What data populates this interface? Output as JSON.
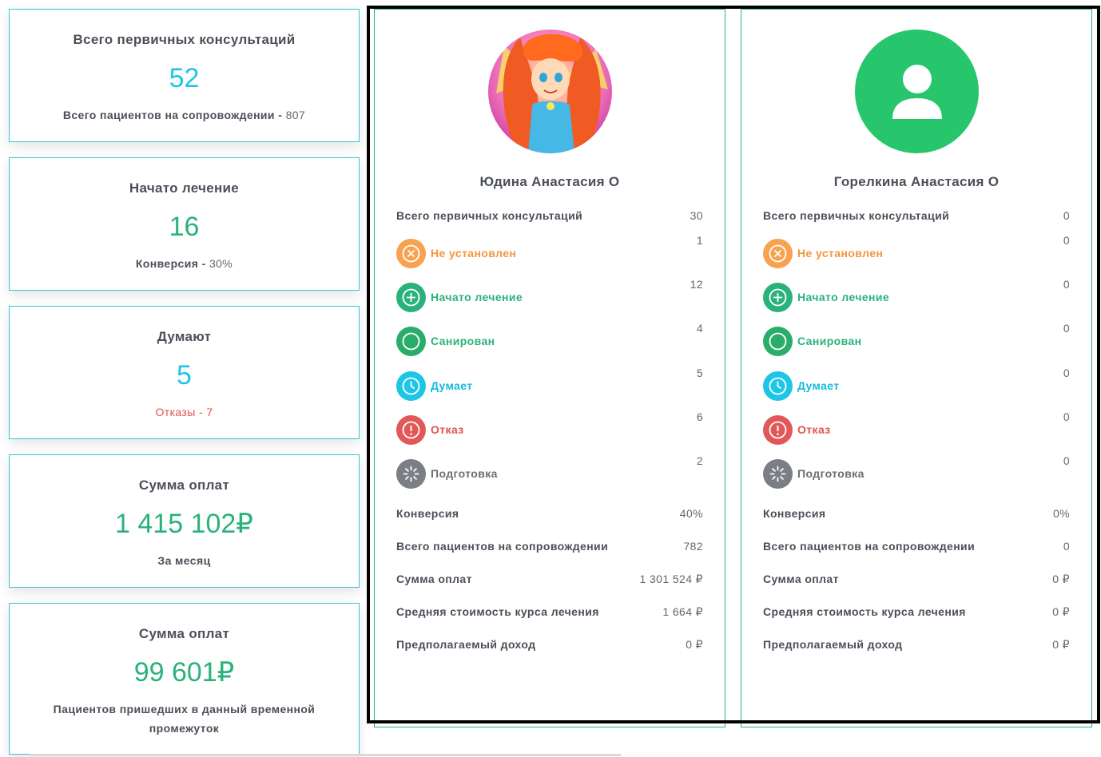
{
  "summary": [
    {
      "title": "Всего первичных консультаций",
      "value": "52",
      "value_color": "cyan",
      "sub_label": "Всего пациентов на сопровождении - ",
      "sub_value": "807"
    },
    {
      "title": "Начато лечение",
      "value": "16",
      "value_color": "green",
      "sub_label": "Конверсия - ",
      "sub_value": "30%"
    },
    {
      "title": "Думают",
      "value": "5",
      "value_color": "cyan",
      "sub_label": "Отказы - ",
      "sub_value": "7"
    },
    {
      "title": "Сумма оплат",
      "value": "1 415 102₽",
      "value_color": "green",
      "sub_label": "За месяц",
      "sub_value": ""
    },
    {
      "title": "Сумма оплат",
      "value": "99 601₽",
      "value_color": "green",
      "sub_label": "Пациентов пришедших в данный временной промежуток",
      "sub_value": ""
    }
  ],
  "employees": [
    {
      "name": "Юдина Анастасия О",
      "total_consultations_label": "Всего первичных консультаций",
      "total_consultations": "30",
      "statuses": [
        {
          "label": "Не установлен",
          "value": "1",
          "icon": "x-circle-icon"
        },
        {
          "label": "Начато лечение",
          "value": "12",
          "icon": "plus-circle-icon"
        },
        {
          "label": "Санирован",
          "value": "4",
          "icon": "circle-icon"
        },
        {
          "label": "Думает",
          "value": "5",
          "icon": "clock-icon"
        },
        {
          "label": "Отказ",
          "value": "6",
          "icon": "exclamation-icon"
        },
        {
          "label": "Подготовка",
          "value": "2",
          "icon": "spinner-icon"
        }
      ],
      "metrics": [
        {
          "label": "Конверсия",
          "value": "40%"
        },
        {
          "label": "Всего пациентов на сопровождении",
          "value": "782"
        },
        {
          "label": "Сумма оплат",
          "value": "1 301 524 ₽"
        },
        {
          "label": "Средняя стоимость курса лечения",
          "value": "1 664 ₽"
        },
        {
          "label": "Предполагаемый доход",
          "value": "0 ₽"
        }
      ]
    },
    {
      "name": "Горелкина Анастасия О",
      "total_consultations_label": "Всего первичных консультаций",
      "total_consultations": "0",
      "statuses": [
        {
          "label": "Не установлен",
          "value": "0",
          "icon": "x-circle-icon"
        },
        {
          "label": "Начато лечение",
          "value": "0",
          "icon": "plus-circle-icon"
        },
        {
          "label": "Санирован",
          "value": "0",
          "icon": "circle-icon"
        },
        {
          "label": "Думает",
          "value": "0",
          "icon": "clock-icon"
        },
        {
          "label": "Отказ",
          "value": "0",
          "icon": "exclamation-icon"
        },
        {
          "label": "Подготовка",
          "value": "0",
          "icon": "spinner-icon"
        }
      ],
      "metrics": [
        {
          "label": "Конверсия",
          "value": "0%"
        },
        {
          "label": "Всего пациентов на сопровождении",
          "value": "0"
        },
        {
          "label": "Сумма оплат",
          "value": "0 ₽"
        },
        {
          "label": "Средняя стоимость курса лечения",
          "value": "0 ₽"
        },
        {
          "label": "Предполагаемый доход",
          "value": "0 ₽"
        }
      ]
    }
  ],
  "colors": {
    "cyan": "#1ec6e6",
    "green": "#2ab27b",
    "orange": "#f7a24e",
    "red": "#e25757",
    "grey": "#7b7e84",
    "border": "#36c6d3"
  }
}
